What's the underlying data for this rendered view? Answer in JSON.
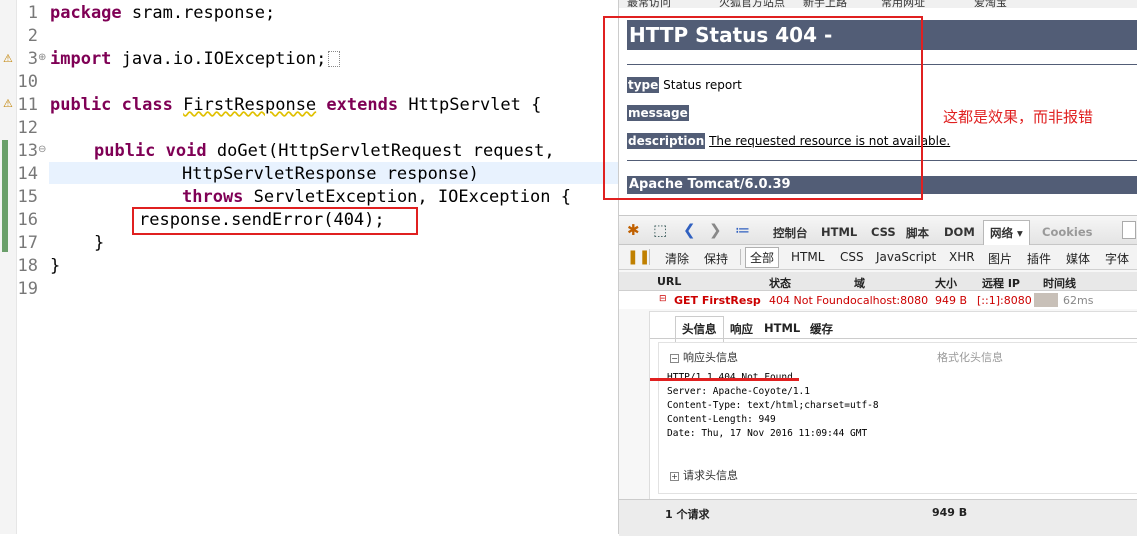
{
  "editor": {
    "line_numbers": [
      "1",
      "2",
      "3",
      "10",
      "11",
      "12",
      "13",
      "14",
      "15",
      "16",
      "17",
      "18",
      "19"
    ],
    "line1": {
      "kw": "package",
      "rest": " sram.response;"
    },
    "line3": {
      "kw": "import",
      "rest": " java.io.IOException;"
    },
    "line11": {
      "kw1": "public",
      "kw2": "class",
      "cls": "FirstResponse",
      "kw3": "extends",
      "rest": " HttpServlet {"
    },
    "line13": {
      "kw1": "public",
      "kw2": "void",
      "rest": " doGet(HttpServletRequest request,"
    },
    "line14": "HttpServletResponse response)",
    "line15": {
      "kw": "throws",
      "rest": " ServletException, IOException {"
    },
    "line16": "response.sendError(404);",
    "line17": "}",
    "line18": "}"
  },
  "browser": {
    "bookmarks": [
      "最常访问",
      "火狐官方站点",
      "新手上路",
      "常用网址",
      "爱淘宝"
    ],
    "page": {
      "title": "HTTP Status 404 -",
      "type_label": "type",
      "type_value": "Status report",
      "message_label": "message",
      "description_label": "description",
      "description_value": "The requested resource is not available.",
      "footer": "Apache Tomcat/6.0.39"
    },
    "annotation": "这都是效果，而非报错"
  },
  "firebug": {
    "tabs": [
      "控制台",
      "HTML",
      "CSS",
      "脚本",
      "DOM",
      "网络 ▾",
      "Cookies"
    ],
    "filters": [
      "清除",
      "保持",
      "全部",
      "HTML",
      "CSS",
      "JavaScript",
      "XHR",
      "图片",
      "插件",
      "媒体",
      "字体"
    ],
    "columns": [
      "URL",
      "状态",
      "域",
      "大小",
      "远程 IP",
      "时间线"
    ],
    "request": {
      "url": "GET FirstResp",
      "status": "404 Not Found",
      "domain": "localhost:8080",
      "size": "949 B",
      "remote_ip": "[::1]:8080",
      "time": "62ms"
    },
    "detail_tabs": [
      "头信息",
      "响应",
      "HTML",
      "缓存"
    ],
    "response_headers_title": "响应头信息",
    "format_link": "格式化头信息",
    "raw_headers": [
      "HTTP/1.1 404 Not Found",
      "Server: Apache-Coyote/1.1",
      "Content-Type: text/html;charset=utf-8",
      "Content-Length: 949",
      "Date: Thu, 17 Nov 2016 11:09:44 GMT"
    ],
    "request_headers_title": "请求头信息",
    "summary_count": "1 个请求",
    "summary_size": "949 B"
  }
}
